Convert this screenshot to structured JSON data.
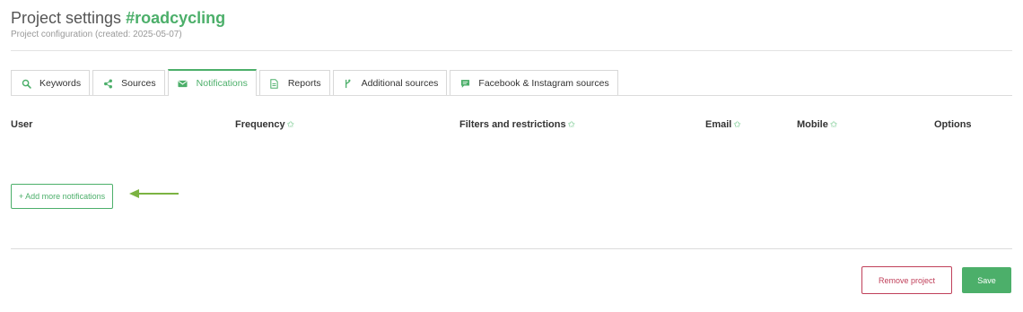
{
  "page": {
    "title_prefix": "Project settings",
    "title_tag": "#roadcycling",
    "subtitle": "Project configuration (created: 2025-05-07)"
  },
  "tabs": [
    {
      "label": "Keywords",
      "icon": "search-icon",
      "active": false
    },
    {
      "label": "Sources",
      "icon": "share-icon",
      "active": false
    },
    {
      "label": "Notifications",
      "icon": "envelope-icon",
      "active": true
    },
    {
      "label": "Reports",
      "icon": "document-icon",
      "active": false
    },
    {
      "label": "Additional sources",
      "icon": "branch-icon",
      "active": false
    },
    {
      "label": "Facebook & Instagram sources",
      "icon": "chat-icon",
      "active": false
    }
  ],
  "table": {
    "columns": [
      {
        "label": "User",
        "star": false
      },
      {
        "label": "Frequency",
        "star": true
      },
      {
        "label": "Filters and restrictions",
        "star": true
      },
      {
        "label": "Email",
        "star": true
      },
      {
        "label": "Mobile",
        "star": true
      },
      {
        "label": "Options",
        "star": false
      }
    ],
    "star_glyph": "✩"
  },
  "actions": {
    "add_notifications": "+ Add more notifications",
    "remove_project": "Remove project",
    "save": "Save"
  },
  "colors": {
    "accent": "#4caf6a",
    "danger": "#c0405a",
    "arrow": "#7cb342"
  }
}
